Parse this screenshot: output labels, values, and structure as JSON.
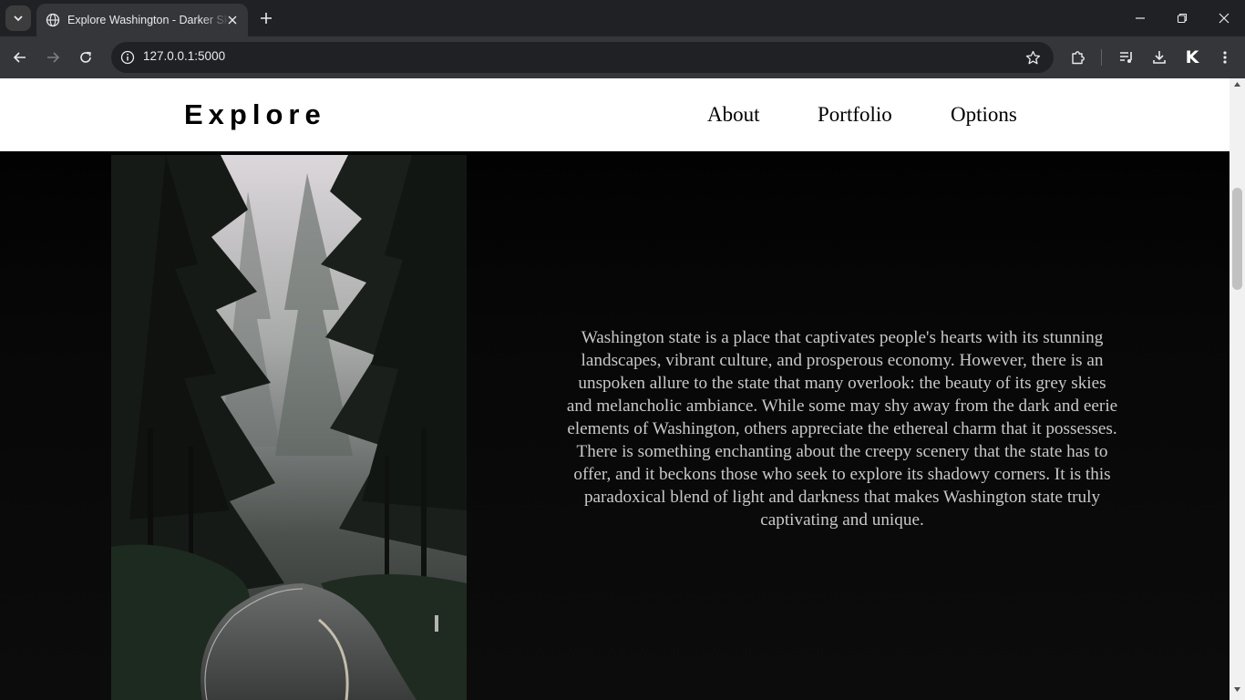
{
  "browser": {
    "tab": {
      "title": "Explore Washington - Darker Skies"
    },
    "address_bar": {
      "url": "127.0.0.1:5000"
    },
    "profile_initial": "K"
  },
  "site": {
    "brand": "Explore",
    "nav": {
      "about": "About",
      "portfolio": "Portfolio",
      "options": "Options"
    },
    "intro_text": "Washington state is a place that captivates people's hearts with its stunning landscapes, vibrant culture, and prosperous economy. However, there is an unspoken allure to the state that many overlook: the beauty of its grey skies and melancholic ambiance. While some may shy away from the dark and eerie elements of Washington, others appreciate the ethereal charm that it possesses. There is something enchanting about the creepy scenery that the state has to offer, and it beckons those who seek to explore its shadowy corners. It is this paradoxical blend of light and darkness that makes Washington state truly captivating and unique."
  },
  "colors": {
    "chrome_dark": "#202124",
    "chrome_toolbar": "#35363a",
    "page_bg": "#0b0b0b",
    "header_bg": "#ffffff",
    "body_text": "#c8c8c8"
  }
}
